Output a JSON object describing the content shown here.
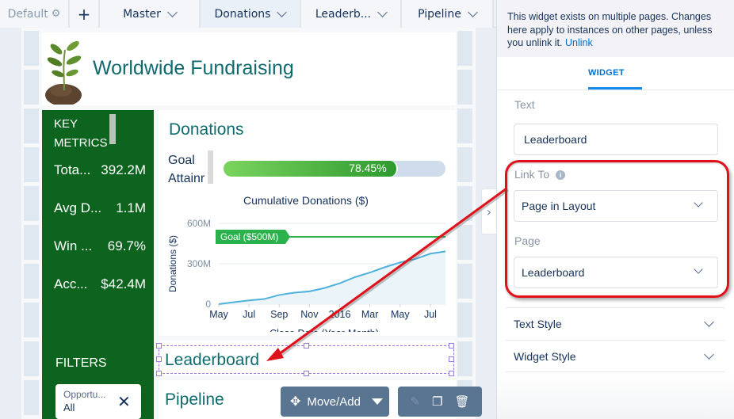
{
  "tabbar": {
    "default_label": "Default",
    "default_icon": "gear-icon",
    "add_label": "+",
    "pages": [
      {
        "label": "Master",
        "active": false
      },
      {
        "label": "Donations",
        "active": true
      },
      {
        "label": "Leaderb...",
        "active": false
      },
      {
        "label": "Pipeline",
        "active": false
      }
    ]
  },
  "dashboard": {
    "title": "Worldwide Fundraising",
    "key_metrics": {
      "heading_line1": "KEY",
      "heading_line2": "METRICS",
      "items": [
        {
          "label": "Tota...",
          "value": "392.2M"
        },
        {
          "label": "Avg D...",
          "value": "1.1M"
        },
        {
          "label": "Win ...",
          "value": "69.7%"
        },
        {
          "label": "Acc...",
          "value": "$42.4M"
        }
      ]
    },
    "filters": {
      "heading": "FILTERS",
      "pill": {
        "name": "Opportu...",
        "value": "All"
      }
    },
    "donations": {
      "title": "Donations",
      "goal_label_line1": "Goal",
      "goal_label_line2": "Attainr",
      "goal_progress_percent": 78.45,
      "goal_progress_text": "78.45%"
    },
    "leaderboard_text": "Leaderboard",
    "pipeline_text": "Pipeline",
    "toolbar": {
      "move_add_label": "Move/Add",
      "edit_icon": "pencil-icon",
      "clone_icon": "clone-icon",
      "delete_icon": "trash-icon"
    }
  },
  "chart_data": {
    "type": "area",
    "title": "Cumulative Donations ($)",
    "xlabel": "Close Date (Year-Month)",
    "ylabel": "Donations ($)",
    "x": [
      "2015-05",
      "2015-06",
      "2015-07",
      "2015-08",
      "2015-09",
      "2015-10",
      "2015-11",
      "2015-12",
      "2016-01",
      "2016-02",
      "2016-03",
      "2016-04",
      "2016-05",
      "2016-06",
      "2016-07",
      "2016-08"
    ],
    "x_tick_labels": [
      "May",
      "Jul",
      "Sep",
      "Nov",
      "2016",
      "Mar",
      "May",
      "Jul"
    ],
    "y_ticks": [
      "0",
      "300M",
      "600M"
    ],
    "ylim": [
      0,
      600
    ],
    "y_units": "M",
    "series": [
      {
        "name": "Cumulative Donations",
        "color": "#4fb1dd",
        "values": [
          0,
          15,
          28,
          38,
          68,
          85,
          95,
          120,
          155,
          200,
          235,
          275,
          310,
          335,
          375,
          392
        ]
      }
    ],
    "reference_line": {
      "label": "Goal ($500M)",
      "value": 500,
      "color": "#2bb24c"
    },
    "grid": true
  },
  "panel": {
    "notice_text": "This widget exists on multiple pages. Changes here apply to instances on other pages, unless you unlink it.",
    "notice_link": "Unlink",
    "tab_label": "WIDGET",
    "text_label": "Text",
    "text_value": "Leaderboard",
    "link_to_label": "Link To",
    "link_to_value": "Page in Layout",
    "page_label": "Page",
    "page_value": "Leaderboard",
    "sections": [
      "Text Style",
      "Widget Style"
    ]
  },
  "colors": {
    "accent": "#0070d2",
    "title_teal": "#0f6b6e",
    "metrics_green": "#0c641e",
    "annotation_red": "#e0101a"
  }
}
